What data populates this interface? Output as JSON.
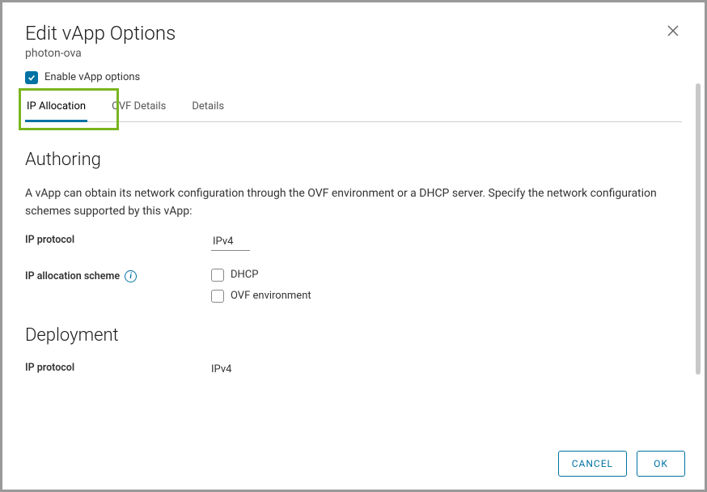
{
  "header": {
    "title": "Edit vApp Options",
    "subtitle": "photon-ova"
  },
  "enable_checkbox": {
    "label": "Enable vApp options",
    "checked": true
  },
  "tabs": {
    "ip_allocation": "IP Allocation",
    "ovf_details": "OVF Details",
    "details": "Details"
  },
  "authoring": {
    "heading": "Authoring",
    "description": "A vApp can obtain its network configuration through the OVF environment or a DHCP server. Specify the network configuration schemes supported by this vApp:",
    "ip_protocol_label": "IP protocol",
    "ip_protocol_value": "IPv4",
    "scheme_label": "IP allocation scheme",
    "dhcp_label": "DHCP",
    "ovf_env_label": "OVF environment"
  },
  "deployment": {
    "heading": "Deployment",
    "ip_protocol_label": "IP protocol",
    "ip_protocol_value": "IPv4"
  },
  "footer": {
    "cancel": "CANCEL",
    "ok": "OK"
  }
}
